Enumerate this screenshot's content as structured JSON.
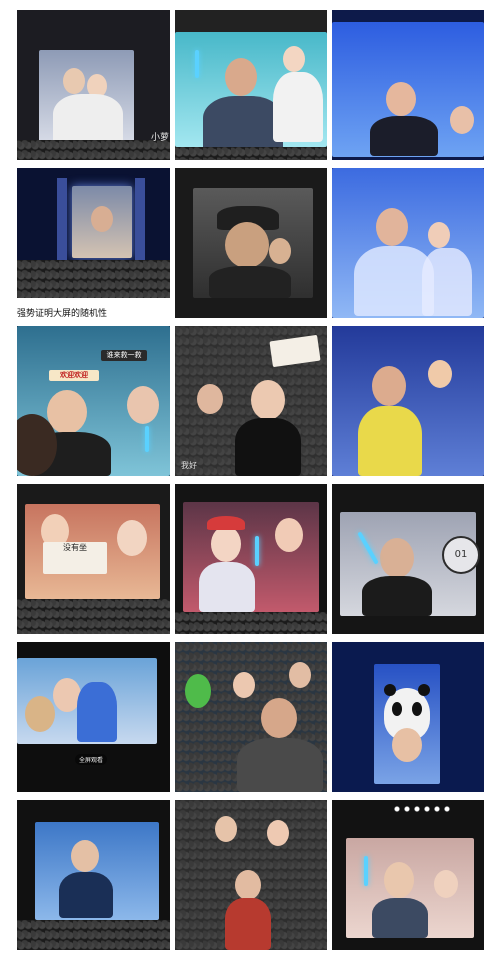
{
  "grid": {
    "tiles": [
      {
        "id": "r1c1",
        "watermark": "小萝"
      },
      {
        "id": "r1c2"
      },
      {
        "id": "r1c3"
      },
      {
        "id": "r2c1"
      },
      {
        "id": "r2c2"
      },
      {
        "id": "r2c3"
      },
      {
        "id": "r3c1",
        "signs": [
          "欢迎欢迎",
          "谁来救一救"
        ]
      },
      {
        "id": "r3c2",
        "caption": "我好"
      },
      {
        "id": "r3c3"
      },
      {
        "id": "r4c1",
        "sign": "没有坐"
      },
      {
        "id": "r4c2"
      },
      {
        "id": "r4c3",
        "badge": "01"
      },
      {
        "id": "r5c1",
        "subcaption": "全屏观看"
      },
      {
        "id": "r5c2"
      },
      {
        "id": "r5c3"
      },
      {
        "id": "r6c1"
      },
      {
        "id": "r6c2"
      },
      {
        "id": "r6c3"
      }
    ]
  },
  "caption_row2": "强势证明大屏的随机性"
}
